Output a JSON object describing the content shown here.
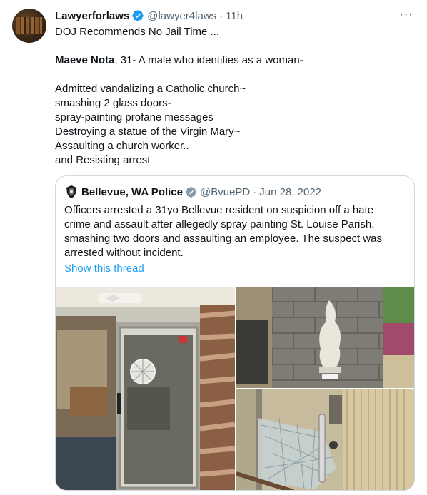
{
  "tweet": {
    "author_name": "Lawyerforlaws",
    "handle": "@lawyer4laws",
    "separator": "·",
    "time": "11h",
    "more_label": "···",
    "lines": [
      "DOJ Recommends No Jail Time ...",
      "",
      {
        "bold": "Maeve Nota",
        "rest": ", 31- A male who identifies as a woman-"
      },
      "",
      "Admitted vandalizing a Catholic church~",
      "smashing 2 glass doors-",
      "spray-painting profane messages",
      "Destroying a statue of the Virgin Mary~",
      "Assaulting a church worker..",
      "and Resisting arrest"
    ]
  },
  "quoted": {
    "author_name": "Bellevue, WA Police",
    "handle": "@BvuePD",
    "separator": "·",
    "date": "Jun 28, 2022",
    "lines": [
      "Officers arrested a 31yo Bellevue resident on suspicion off a hate",
      "crime and assault after allegedly spray painting St. Louise Parish,",
      "smashing two doors and assaulting an employee. The suspect was",
      "arrested without incident."
    ],
    "show_thread": "Show this thread"
  },
  "colors": {
    "accent": "#1d9bf0",
    "verified_blue": "#1d9bf0",
    "gov_gray": "#829aab",
    "muted": "#536471",
    "text": "#0f1419",
    "border": "#cfd9de"
  }
}
